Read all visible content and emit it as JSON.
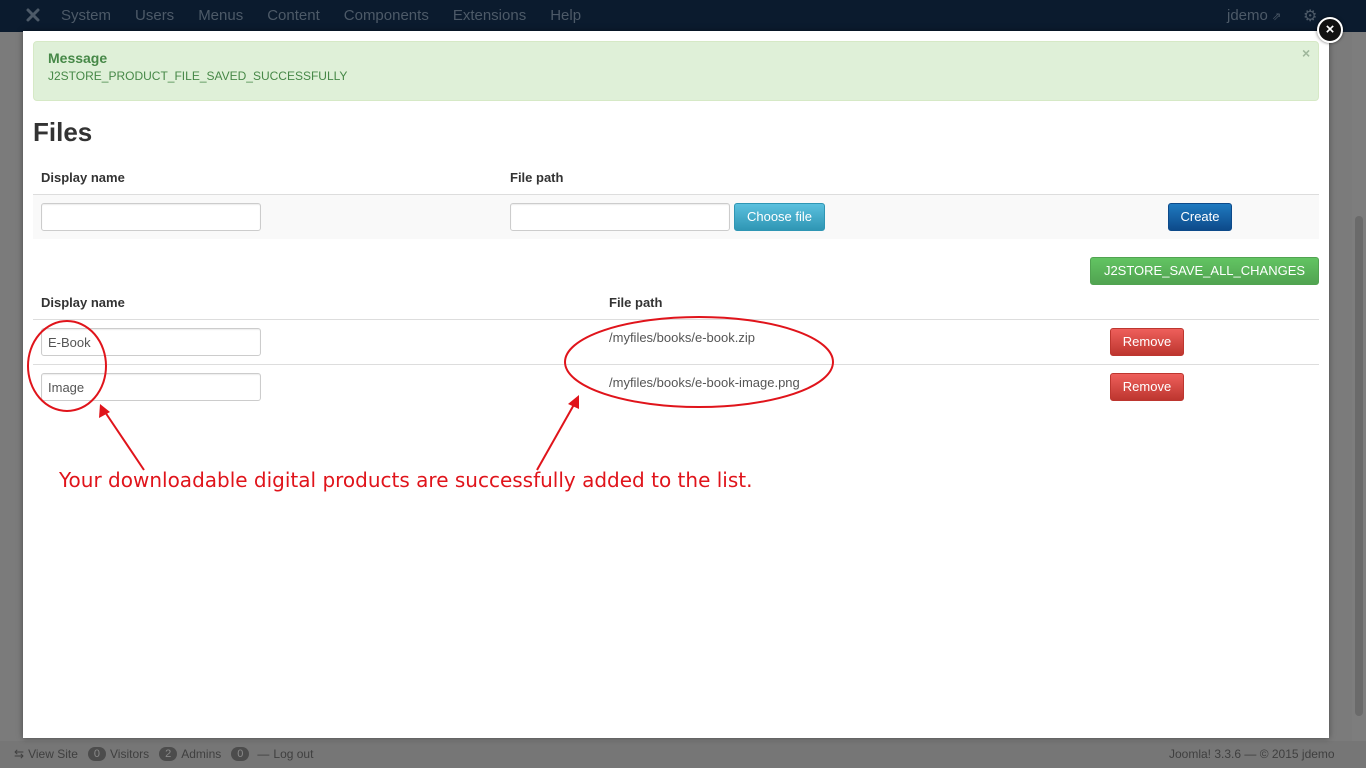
{
  "topbar": {
    "menu": [
      "System",
      "Users",
      "Menus",
      "Content",
      "Components",
      "Extensions",
      "Help"
    ],
    "user": "jdemo",
    "user_icon": "external-link-icon",
    "settings_icon": "gear-icon"
  },
  "statusbar": {
    "view_site": "View Site",
    "visitors_count": "0",
    "visitors_label": "Visitors",
    "admins_count": "2",
    "admins_label": "Admins",
    "messages_count": "0",
    "logout": "Log out",
    "footer": "Joomla! 3.3.6 — © 2015 jdemo"
  },
  "alert": {
    "title": "Message",
    "text": "J2STORE_PRODUCT_FILE_SAVED_SUCCESSFULLY",
    "close": "×"
  },
  "close_button": "×",
  "files": {
    "heading": "Files",
    "new_form": {
      "col_display_name": "Display name",
      "col_file_path": "File path",
      "display_name_value": "",
      "file_path_value": "",
      "choose_file_label": "Choose file",
      "create_label": "Create"
    },
    "save_all_label": "J2STORE_SAVE_ALL_CHANGES",
    "list": {
      "col_display_name": "Display name",
      "col_file_path": "File path",
      "rows": [
        {
          "display_name": "E-Book",
          "file_path": "/myfiles/books/e-book.zip",
          "remove_label": "Remove"
        },
        {
          "display_name": "Image",
          "file_path": "/myfiles/books/e-book-image.png",
          "remove_label": "Remove"
        }
      ]
    }
  },
  "annotation": {
    "text": "Your downloadable digital products are successfully added to the list.",
    "color": "#e0141b"
  },
  "colors": {
    "success_bg": "#dff0d8",
    "success_text": "#468847",
    "primary": "#0d4a8a",
    "info": "#2f96b4",
    "danger": "#bd362f",
    "success_btn": "#51a351"
  }
}
